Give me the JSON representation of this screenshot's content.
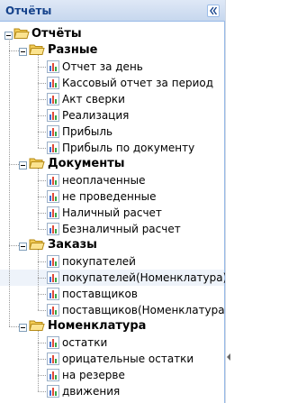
{
  "panel": {
    "title": "Отчёты"
  },
  "tree": {
    "root": "Отчёты",
    "groups": [
      {
        "label": "Разные",
        "items": [
          "Отчет за день",
          "Кассовый отчет за период",
          "Акт сверки",
          "Реализация",
          "Прибыль",
          "Прибыль по документу"
        ]
      },
      {
        "label": "Документы",
        "items": [
          "неоплаченные",
          "не проведенные",
          "Наличный расчет",
          "Безналичный расчет"
        ]
      },
      {
        "label": "Заказы",
        "items": [
          "покупателей",
          "покупателей(Номенклатура)",
          "поставщиков",
          "поставщиков(Номенклатура)"
        ],
        "selected_index": 1
      },
      {
        "label": "Номенклатура",
        "items": [
          "остатки",
          "орицательные остатки",
          "на резерве",
          "движения"
        ]
      }
    ]
  },
  "colors": {
    "header_text": "#15428b",
    "header_bg": "#c6d7ee",
    "border": "#99bbe8",
    "folder": "#f5d36b"
  }
}
